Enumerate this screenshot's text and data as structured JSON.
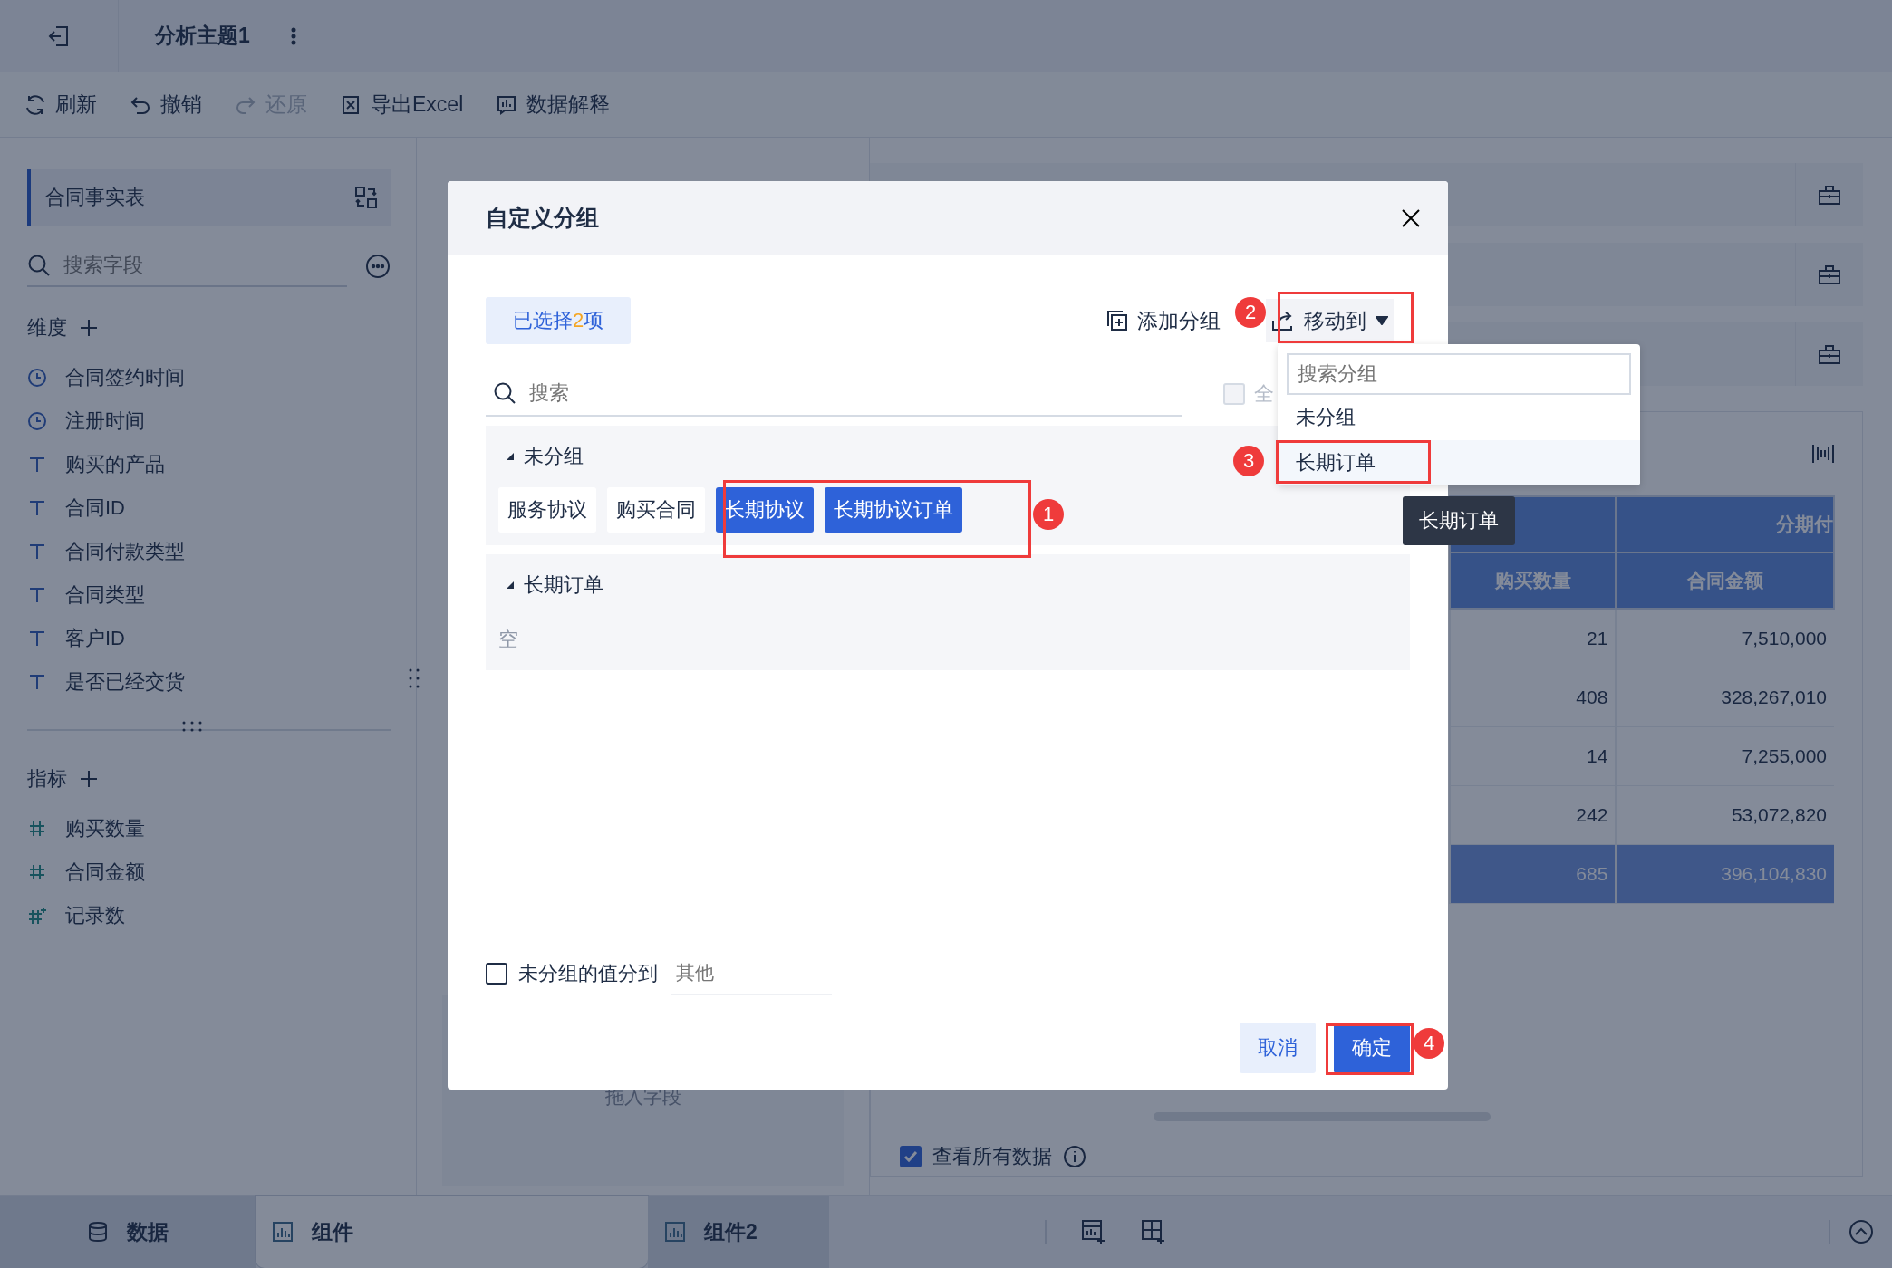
{
  "topbar": {
    "title": "分析主题1"
  },
  "toolbar": [
    {
      "kind": "refresh",
      "label": "刷新",
      "disabled": false
    },
    {
      "kind": "undo",
      "label": "撤销",
      "disabled": false
    },
    {
      "kind": "redo",
      "label": "还原",
      "disabled": true
    },
    {
      "kind": "excel",
      "label": "导出Excel",
      "disabled": false
    },
    {
      "kind": "explain",
      "label": "数据解释",
      "disabled": false
    }
  ],
  "sidebar": {
    "table_name": "合同事实表",
    "search": {
      "placeholder": "搜索字段"
    },
    "dimensions": {
      "title": "维度",
      "fields": [
        {
          "kind": "date",
          "name": "合同签约时间"
        },
        {
          "kind": "date",
          "name": "注册时间"
        },
        {
          "kind": "text",
          "name": "购买的产品"
        },
        {
          "kind": "text",
          "name": "合同ID"
        },
        {
          "kind": "text",
          "name": "合同付款类型"
        },
        {
          "kind": "text",
          "name": "合同类型"
        },
        {
          "kind": "text",
          "name": "客户ID"
        },
        {
          "kind": "text",
          "name": "是否已经交货"
        }
      ]
    },
    "measures": {
      "title": "指标",
      "fields": [
        {
          "kind": "number",
          "name": "购买数量"
        },
        {
          "kind": "number",
          "name": "合同金额"
        },
        {
          "kind": "count",
          "name": "记录数"
        }
      ]
    }
  },
  "drop_zone": {
    "hint": "拖入字段"
  },
  "table": {
    "header_group": "分期付",
    "columns": [
      "购买数量",
      "合同金额"
    ],
    "rows": [
      [
        "21",
        "7,510,000"
      ],
      [
        "408",
        "328,267,010"
      ],
      [
        "14",
        "7,255,000"
      ],
      [
        "242",
        "53,072,820"
      ]
    ],
    "total": [
      "685",
      "396,104,830"
    ]
  },
  "view_all": {
    "label": "查看所有数据",
    "checked": true
  },
  "bottom_tabs": [
    {
      "kind": "data",
      "label": "数据",
      "selected": false
    },
    {
      "kind": "chart",
      "label": "组件",
      "selected": true
    },
    {
      "kind": "chart",
      "label": "组件2",
      "selected": false
    }
  ],
  "dialog": {
    "title": "自定义分组",
    "selected_count": {
      "prefix": "已选择",
      "count": "2",
      "suffix": "项"
    },
    "add_group": "添加分组",
    "move_to": "移动到",
    "search": {
      "placeholder": "搜索"
    },
    "select_all": {
      "label": "全",
      "checked": false
    },
    "groups": [
      {
        "name": "未分组",
        "expanded": true,
        "items": [
          {
            "label": "服务协议",
            "selected": false
          },
          {
            "label": "购买合同",
            "selected": false
          },
          {
            "label": "长期协议",
            "selected": true
          },
          {
            "label": "长期协议订单",
            "selected": true
          }
        ]
      },
      {
        "name": "长期订单",
        "expanded": true,
        "empty_text": "空"
      }
    ],
    "ungrouped_option": {
      "label": "未分组的值分到",
      "checked": false,
      "placeholder": "其他"
    },
    "buttons": [
      {
        "kind": "secondary",
        "label": "取消"
      },
      {
        "kind": "primary",
        "label": "确定"
      }
    ]
  },
  "move_menu": {
    "search": {
      "placeholder": "搜索分组"
    },
    "items": [
      {
        "label": "未分组",
        "highlighted": false
      },
      {
        "label": "长期订单",
        "highlighted": true
      }
    ]
  },
  "tooltip": "长期订单",
  "annotations": [
    {
      "number": "1"
    },
    {
      "number": "2"
    },
    {
      "number": "3"
    },
    {
      "number": "4"
    }
  ]
}
